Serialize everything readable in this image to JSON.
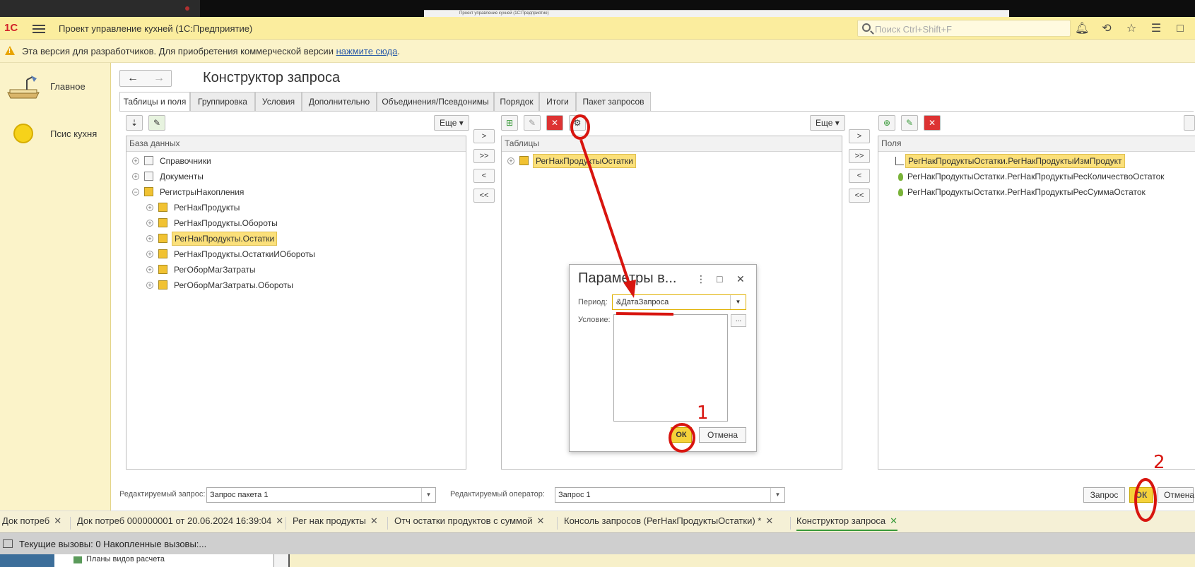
{
  "window": {
    "title": "Проект управление кухней (1С:Предприятие)",
    "logo": "1С",
    "mini_title": "Проект управление кухней (1С:Предприятие)",
    "search_placeholder": "Поиск Ctrl+Shift+F",
    "icons": [
      "bell-icon",
      "history-icon",
      "star-icon",
      "menu-lines-icon",
      "window-icon"
    ]
  },
  "warning": {
    "text": "Эта версия для разработчиков. Для приобретения коммерческой версии ",
    "link": "нажмите сюда",
    "suffix": "."
  },
  "sections": [
    {
      "label": "Главное",
      "icon": "desk-lamp-icon"
    },
    {
      "label": "Псис кухня",
      "icon": "sun-icon"
    }
  ],
  "constructor": {
    "title": "Конструктор запроса",
    "tabs": [
      "Таблицы и поля",
      "Группировка",
      "Условия",
      "Дополнительно",
      "Объединения/Псевдонимы",
      "Порядок",
      "Итоги",
      "Пакет запросов"
    ],
    "active_tab": "Таблицы и поля",
    "more_label": "Еще",
    "arrow_labels": [
      ">",
      ">>",
      "<",
      "<<"
    ],
    "database": {
      "header": "База данных",
      "items": [
        {
          "label": "Справочники",
          "level": 0,
          "expander": "+"
        },
        {
          "label": "Документы",
          "level": 0,
          "expander": "+"
        },
        {
          "label": "РегистрыНакопления",
          "level": 0,
          "expander": "−"
        },
        {
          "label": "РегНакПродукты",
          "level": 1,
          "expander": "+"
        },
        {
          "label": "РегНакПродукты.Обороты",
          "level": 1,
          "expander": "+"
        },
        {
          "label": "РегНакПродукты.Остатки",
          "level": 1,
          "expander": "+",
          "selected": true
        },
        {
          "label": "РегНакПродукты.ОстаткиИОбороты",
          "level": 1,
          "expander": "+"
        },
        {
          "label": "РегОборМагЗатраты",
          "level": 1,
          "expander": "+"
        },
        {
          "label": "РегОборМагЗатраты.Обороты",
          "level": 1,
          "expander": "+"
        }
      ]
    },
    "tables": {
      "header": "Таблицы",
      "items": [
        {
          "label": "РегНакПродуктыОстатки",
          "expander": "+",
          "selected": true
        }
      ]
    },
    "fields": {
      "header": "Поля",
      "items": [
        {
          "label": "РегНакПродуктыОстатки.РегНакПродуктыИзмПродукт",
          "selected": true,
          "kind": "dimension"
        },
        {
          "label": "РегНакПродуктыОстатки.РегНакПродуктыРесКоличествоОстаток",
          "kind": "resource"
        },
        {
          "label": "РегНакПродуктыОстатки.РегНакПродуктыРесСуммаОстаток",
          "kind": "resource"
        }
      ]
    },
    "bottom": {
      "edited_query_label": "Редактируемый запрос:",
      "edited_query_value": "Запрос пакета 1",
      "edited_operator_label": "Редактируемый оператор:",
      "edited_operator_value": "Запрос 1",
      "query_button": "Запрос",
      "ok_button": "ОК",
      "cancel_button": "Отмена"
    }
  },
  "dialog": {
    "title": "Параметры в...",
    "period_label": "Период:",
    "period_value": "&ДатаЗапроса",
    "condition_label": "Условие:",
    "condition_value": "",
    "dots_label": "...",
    "ok_button": "ОК",
    "cancel_button": "Отмена"
  },
  "open_tabs": [
    "Док потреб",
    "Док потреб 000000001 от 20.06.2024 16:39:04",
    "Рег нак продукты",
    "Отч остатки продуктов с суммой",
    "Консоль запросов (РегНакПродуктыОстатки) *",
    "Конструктор запроса"
  ],
  "active_open_tab": "Конструктор запроса",
  "status": {
    "text": "Текущие вызовы: 0   Накопленные вызовы:..."
  },
  "background": {
    "panel_item": "Планы видов расчета"
  },
  "annotations": {
    "color": "#d8150f",
    "labels": [
      "1",
      "2"
    ]
  }
}
